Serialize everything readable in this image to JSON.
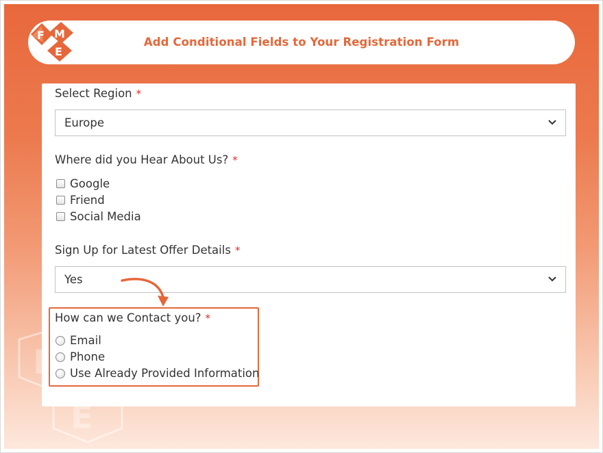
{
  "header": {
    "title": "Add Conditional Fields to Your Registration Form",
    "logo_letters": [
      "F",
      "M",
      "E"
    ]
  },
  "form": {
    "region": {
      "label": "Select Region",
      "required_mark": "*",
      "selected": "Europe"
    },
    "hear_about": {
      "label": "Where did you Hear About Us?",
      "required_mark": "*",
      "options": [
        "Google",
        "Friend",
        "Social Media"
      ]
    },
    "offer": {
      "label": "Sign Up for Latest Offer Details",
      "required_mark": "*",
      "selected": "Yes"
    },
    "contact": {
      "label": "How can we Contact you?",
      "required_mark": "*",
      "options": [
        "Email",
        "Phone",
        "Use Already Provided Information"
      ]
    }
  },
  "colors": {
    "accent": "#e6673a",
    "required": "#e02b27",
    "text": "#333333"
  },
  "icons": {
    "select_arrow": "chevron-down-icon",
    "pointer": "curved-arrow-icon"
  }
}
